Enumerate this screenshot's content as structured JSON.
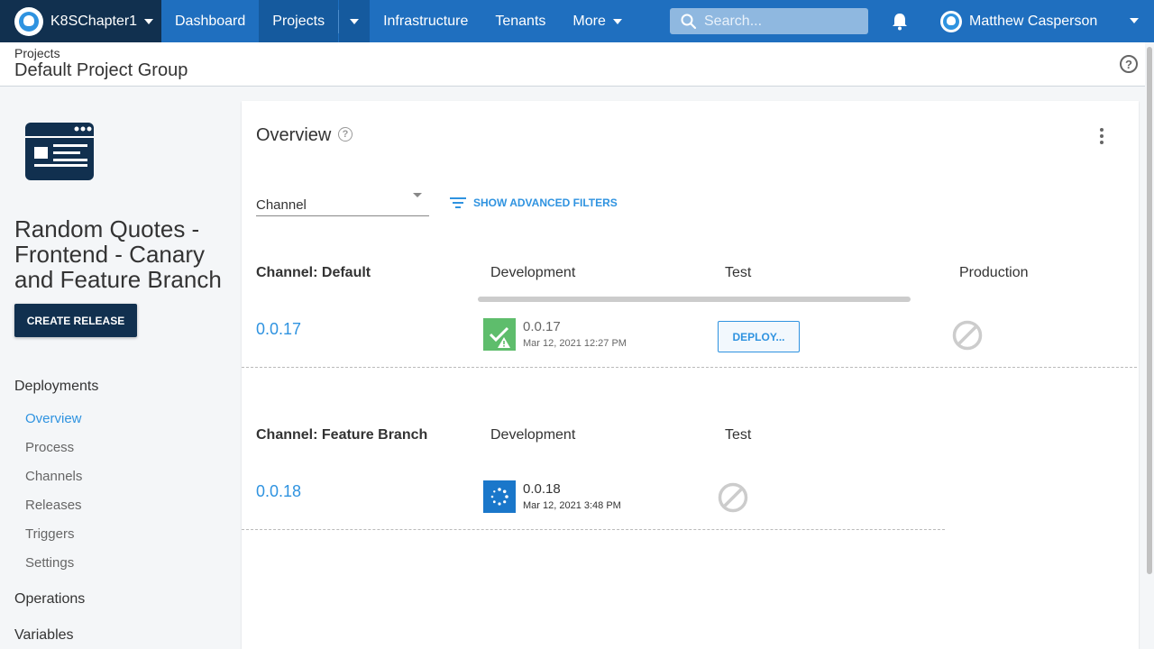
{
  "topnav": {
    "space_name": "K8SChapter1",
    "items": [
      {
        "label": "Dashboard"
      },
      {
        "label": "Projects"
      },
      {
        "label": "Infrastructure"
      },
      {
        "label": "Tenants"
      },
      {
        "label": "More"
      }
    ],
    "search_placeholder": "Search...",
    "user_name": "Matthew Casperson",
    "nav_color": "#1f6fbf",
    "space_color": "#11304f"
  },
  "header": {
    "breadcrumb": "Projects",
    "title": "Default Project Group"
  },
  "sidebar": {
    "project_name": "Random Quotes - Frontend - Canary and Feature Branch",
    "create_release_label": "CREATE RELEASE",
    "sections": {
      "deployments": "Deployments",
      "operations": "Operations",
      "variables": "Variables"
    },
    "links": [
      {
        "label": "Overview",
        "active": true
      },
      {
        "label": "Process"
      },
      {
        "label": "Channels"
      },
      {
        "label": "Releases"
      },
      {
        "label": "Triggers"
      },
      {
        "label": "Settings"
      }
    ]
  },
  "overview": {
    "title": "Overview",
    "channel_filter_label": "Channel",
    "advanced_filters_label": "SHOW ADVANCED FILTERS",
    "channels": [
      {
        "title": "Channel: Default",
        "environments": [
          "Development",
          "Test",
          "Production"
        ],
        "release_version": "0.0.17",
        "development": {
          "version": "0.0.17",
          "date": "Mar 12, 2021 12:27 PM",
          "status": "success-with-warnings",
          "color": "#5ebd6c"
        },
        "test_action": "DEPLOY...",
        "production_status": "no-access"
      },
      {
        "title": "Channel: Feature Branch",
        "environments": [
          "Development",
          "Test"
        ],
        "release_version": "0.0.18",
        "development": {
          "version": "0.0.18",
          "date": "Mar 12, 2021 3:48 PM",
          "status": "in-progress",
          "color": "#1a77ca"
        },
        "test_status": "no-access"
      }
    ]
  }
}
